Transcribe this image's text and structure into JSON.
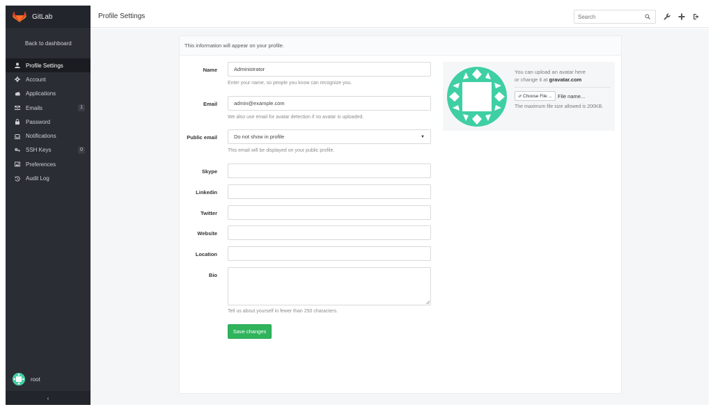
{
  "app": {
    "name": "GitLab"
  },
  "sidebar": {
    "back_label": "Back to dashboard",
    "items": [
      {
        "label": "Profile Settings",
        "icon": "user-icon",
        "active": true
      },
      {
        "label": "Account",
        "icon": "gear-icon"
      },
      {
        "label": "Applications",
        "icon": "cloud-icon"
      },
      {
        "label": "Emails",
        "icon": "envelope-icon",
        "badge": "1"
      },
      {
        "label": "Password",
        "icon": "lock-icon"
      },
      {
        "label": "Notifications",
        "icon": "inbox-icon"
      },
      {
        "label": "SSH Keys",
        "icon": "key-icon",
        "badge": "0"
      },
      {
        "label": "Preferences",
        "icon": "image-icon"
      },
      {
        "label": "Audit Log",
        "icon": "history-icon"
      }
    ],
    "user": "root",
    "collapse_glyph": "‹"
  },
  "header": {
    "title": "Profile Settings",
    "search_placeholder": "Search"
  },
  "panel": {
    "heading": "This information will appear on your profile."
  },
  "form": {
    "name": {
      "label": "Name",
      "value": "Administrator",
      "help": "Enter your name, so people you know can recognize you."
    },
    "email": {
      "label": "Email",
      "value": "admin@example.com",
      "help": "We also use email for avatar detection if no avatar is uploaded."
    },
    "public_email": {
      "label": "Public email",
      "value": "Do not show in profile",
      "help": "This email will be displayed on your public profile."
    },
    "skype": {
      "label": "Skype",
      "value": ""
    },
    "linkedin": {
      "label": "Linkedin",
      "value": ""
    },
    "twitter": {
      "label": "Twitter",
      "value": ""
    },
    "website": {
      "label": "Website",
      "value": ""
    },
    "location": {
      "label": "Location",
      "value": ""
    },
    "bio": {
      "label": "Bio",
      "value": "",
      "help": "Tell us about yourself in fewer than 250 characters."
    },
    "save_label": "Save changes"
  },
  "avatar": {
    "upload_text": "You can upload an avatar here",
    "change_text": "or change it at",
    "gravatar_link": "gravatar.com",
    "choose_label": "Choose File ...",
    "file_name": "File name...",
    "max_size": "The maximum file size allowed is 200KB."
  },
  "colors": {
    "sidebar_bg": "#2b2d35",
    "accent_green": "#2fb45c",
    "avatar_teal": "#3fcfa4"
  }
}
